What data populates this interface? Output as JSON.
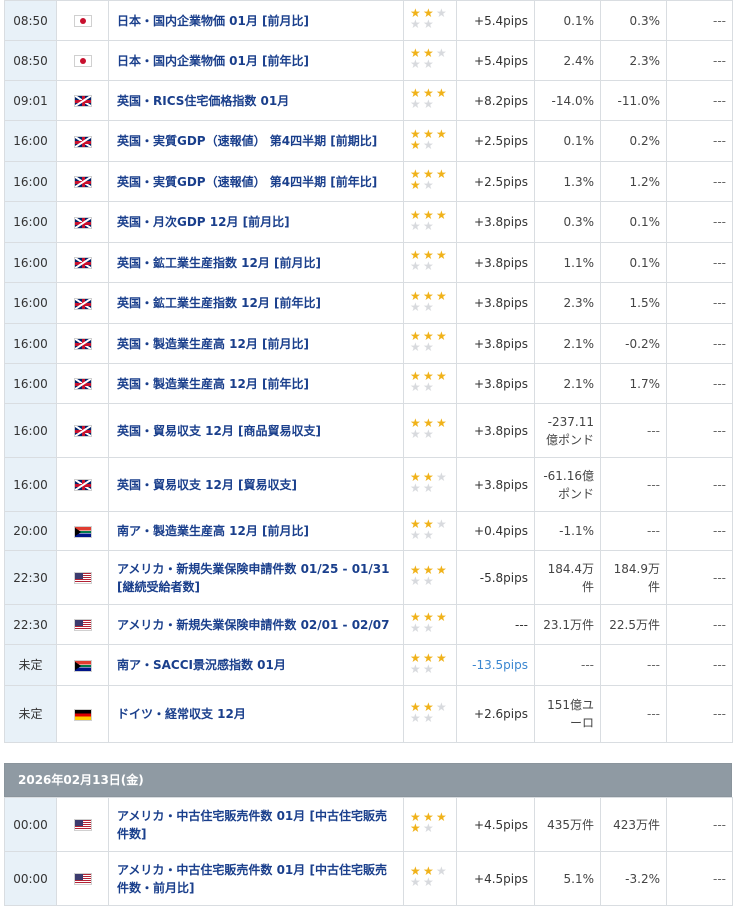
{
  "rows_a": [
    {
      "time": "08:50",
      "flag": "jp",
      "event": "日本・国内企業物価 01月 [前月比]",
      "stars": 2,
      "pips": "+5.4pips",
      "result": "0.1%",
      "forecast": "0.3%",
      "prev": "---"
    },
    {
      "time": "08:50",
      "flag": "jp",
      "event": "日本・国内企業物価 01月 [前年比]",
      "stars": 2,
      "pips": "+5.4pips",
      "result": "2.4%",
      "forecast": "2.3%",
      "prev": "---"
    },
    {
      "time": "09:01",
      "flag": "gb",
      "event": "英国・RICS住宅価格指数 01月",
      "stars": 3,
      "pips": "+8.2pips",
      "result": "-14.0%",
      "forecast": "-11.0%",
      "prev": "---"
    },
    {
      "time": "16:00",
      "flag": "gb",
      "event": "英国・実質GDP（速報値） 第4四半期 [前期比]",
      "stars": 4,
      "pips": "+2.5pips",
      "result": "0.1%",
      "forecast": "0.2%",
      "prev": "---"
    },
    {
      "time": "16:00",
      "flag": "gb",
      "event": "英国・実質GDP（速報値） 第4四半期 [前年比]",
      "stars": 4,
      "pips": "+2.5pips",
      "result": "1.3%",
      "forecast": "1.2%",
      "prev": "---"
    },
    {
      "time": "16:00",
      "flag": "gb",
      "event": "英国・月次GDP 12月 [前月比]",
      "stars": 3,
      "pips": "+3.8pips",
      "result": "0.3%",
      "forecast": "0.1%",
      "prev": "---"
    },
    {
      "time": "16:00",
      "flag": "gb",
      "event": "英国・鉱工業生産指数 12月 [前月比]",
      "stars": 3,
      "pips": "+3.8pips",
      "result": "1.1%",
      "forecast": "0.1%",
      "prev": "---"
    },
    {
      "time": "16:00",
      "flag": "gb",
      "event": "英国・鉱工業生産指数 12月 [前年比]",
      "stars": 3,
      "pips": "+3.8pips",
      "result": "2.3%",
      "forecast": "1.5%",
      "prev": "---"
    },
    {
      "time": "16:00",
      "flag": "gb",
      "event": "英国・製造業生産高 12月 [前月比]",
      "stars": 3,
      "pips": "+3.8pips",
      "result": "2.1%",
      "forecast": "-0.2%",
      "prev": "---"
    },
    {
      "time": "16:00",
      "flag": "gb",
      "event": "英国・製造業生産高 12月 [前年比]",
      "stars": 3,
      "pips": "+3.8pips",
      "result": "2.1%",
      "forecast": "1.7%",
      "prev": "---"
    },
    {
      "time": "16:00",
      "flag": "gb",
      "event": "英国・貿易収支 12月 [商品貿易収支]",
      "stars": 3,
      "pips": "+3.8pips",
      "result": "-237.11\n億ポンド",
      "forecast": "---",
      "prev": "---"
    },
    {
      "time": "16:00",
      "flag": "gb",
      "event": "英国・貿易収支 12月 [貿易収支]",
      "stars": 2,
      "pips": "+3.8pips",
      "result": "-61.16億\nポンド",
      "forecast": "---",
      "prev": "---"
    },
    {
      "time": "20:00",
      "flag": "za",
      "event": "南ア・製造業生産高 12月 [前月比]",
      "stars": 2,
      "pips": "+0.4pips",
      "result": "-1.1%",
      "forecast": "---",
      "prev": "---"
    },
    {
      "time": "22:30",
      "flag": "us",
      "event": "アメリカ・新規失業保険申請件数 01/25 - 01/31 [継続受給者数]",
      "stars": 3,
      "pips": "-5.8pips",
      "result": "184.4万\n件",
      "forecast": "184.9万\n件",
      "prev": "---"
    },
    {
      "time": "22:30",
      "flag": "us",
      "event": "アメリカ・新規失業保険申請件数 02/01 - 02/07",
      "stars": 3,
      "pips": "---",
      "result": "23.1万件",
      "forecast": "22.5万件",
      "prev": "---"
    },
    {
      "time": "未定",
      "flag": "za",
      "event": "南ア・SACCI景況感指数 01月",
      "stars": 3,
      "pips": "-13.5pips",
      "pips_blue": true,
      "result": "---",
      "forecast": "---",
      "prev": "---"
    },
    {
      "time": "未定",
      "flag": "de",
      "event": "ドイツ・経常収支 12月",
      "stars": 2,
      "pips": "+2.6pips",
      "result": "151億ユ\nーロ",
      "forecast": "---",
      "prev": "---"
    }
  ],
  "date_header": "2026年02月13日(金)",
  "rows_b": [
    {
      "time": "00:00",
      "flag": "us",
      "event": "アメリカ・中古住宅販売件数 01月 [中古住宅販売件数]",
      "stars": 4,
      "pips": "+4.5pips",
      "result": "435万件",
      "forecast": "423万件",
      "prev": "---"
    },
    {
      "time": "00:00",
      "flag": "us",
      "event": "アメリカ・中古住宅販売件数 01月 [中古住宅販売件数・前月比]",
      "stars": 2,
      "pips": "+4.5pips",
      "result": "5.1%",
      "forecast": "-3.2%",
      "prev": "---"
    }
  ],
  "flag_names": {
    "jp": "japan-flag-icon",
    "gb": "uk-flag-icon",
    "us": "us-flag-icon",
    "za": "south-africa-flag-icon",
    "de": "germany-flag-icon"
  },
  "colors": {
    "star_on": "#f0b21a",
    "star_off": "#d8dade",
    "event_link": "#1a3f8c",
    "time_bg": "#e8f1f8",
    "date_bar": "#8f9aa3",
    "pips_blue": "#3a86d0"
  }
}
